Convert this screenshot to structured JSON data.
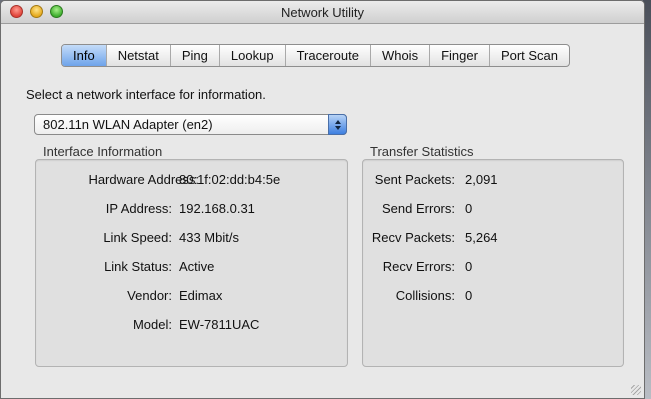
{
  "window": {
    "title": "Network Utility"
  },
  "tabs": [
    {
      "label": "Info",
      "active": true
    },
    {
      "label": "Netstat",
      "active": false
    },
    {
      "label": "Ping",
      "active": false
    },
    {
      "label": "Lookup",
      "active": false
    },
    {
      "label": "Traceroute",
      "active": false
    },
    {
      "label": "Whois",
      "active": false
    },
    {
      "label": "Finger",
      "active": false
    },
    {
      "label": "Port Scan",
      "active": false
    }
  ],
  "prompt": "Select a network interface for information.",
  "interface_popup": {
    "selected": "802.11n WLAN Adapter (en2)"
  },
  "interface_info": {
    "heading": "Interface Information",
    "rows": [
      {
        "label": "Hardware Address:",
        "value": "80:1f:02:dd:b4:5e"
      },
      {
        "label": "IP Address:",
        "value": "192.168.0.31"
      },
      {
        "label": "Link Speed:",
        "value": "433 Mbit/s"
      },
      {
        "label": "Link Status:",
        "value": "Active"
      },
      {
        "label": "Vendor:",
        "value": "Edimax"
      },
      {
        "label": "Model:",
        "value": "EW-7811UAC"
      }
    ]
  },
  "transfer_stats": {
    "heading": "Transfer Statistics",
    "rows": [
      {
        "label": "Sent Packets:",
        "value": "2,091"
      },
      {
        "label": "Send Errors:",
        "value": "0"
      },
      {
        "label": "Recv Packets:",
        "value": "5,264"
      },
      {
        "label": "Recv Errors:",
        "value": "0"
      },
      {
        "label": "Collisions:",
        "value": "0"
      }
    ]
  }
}
